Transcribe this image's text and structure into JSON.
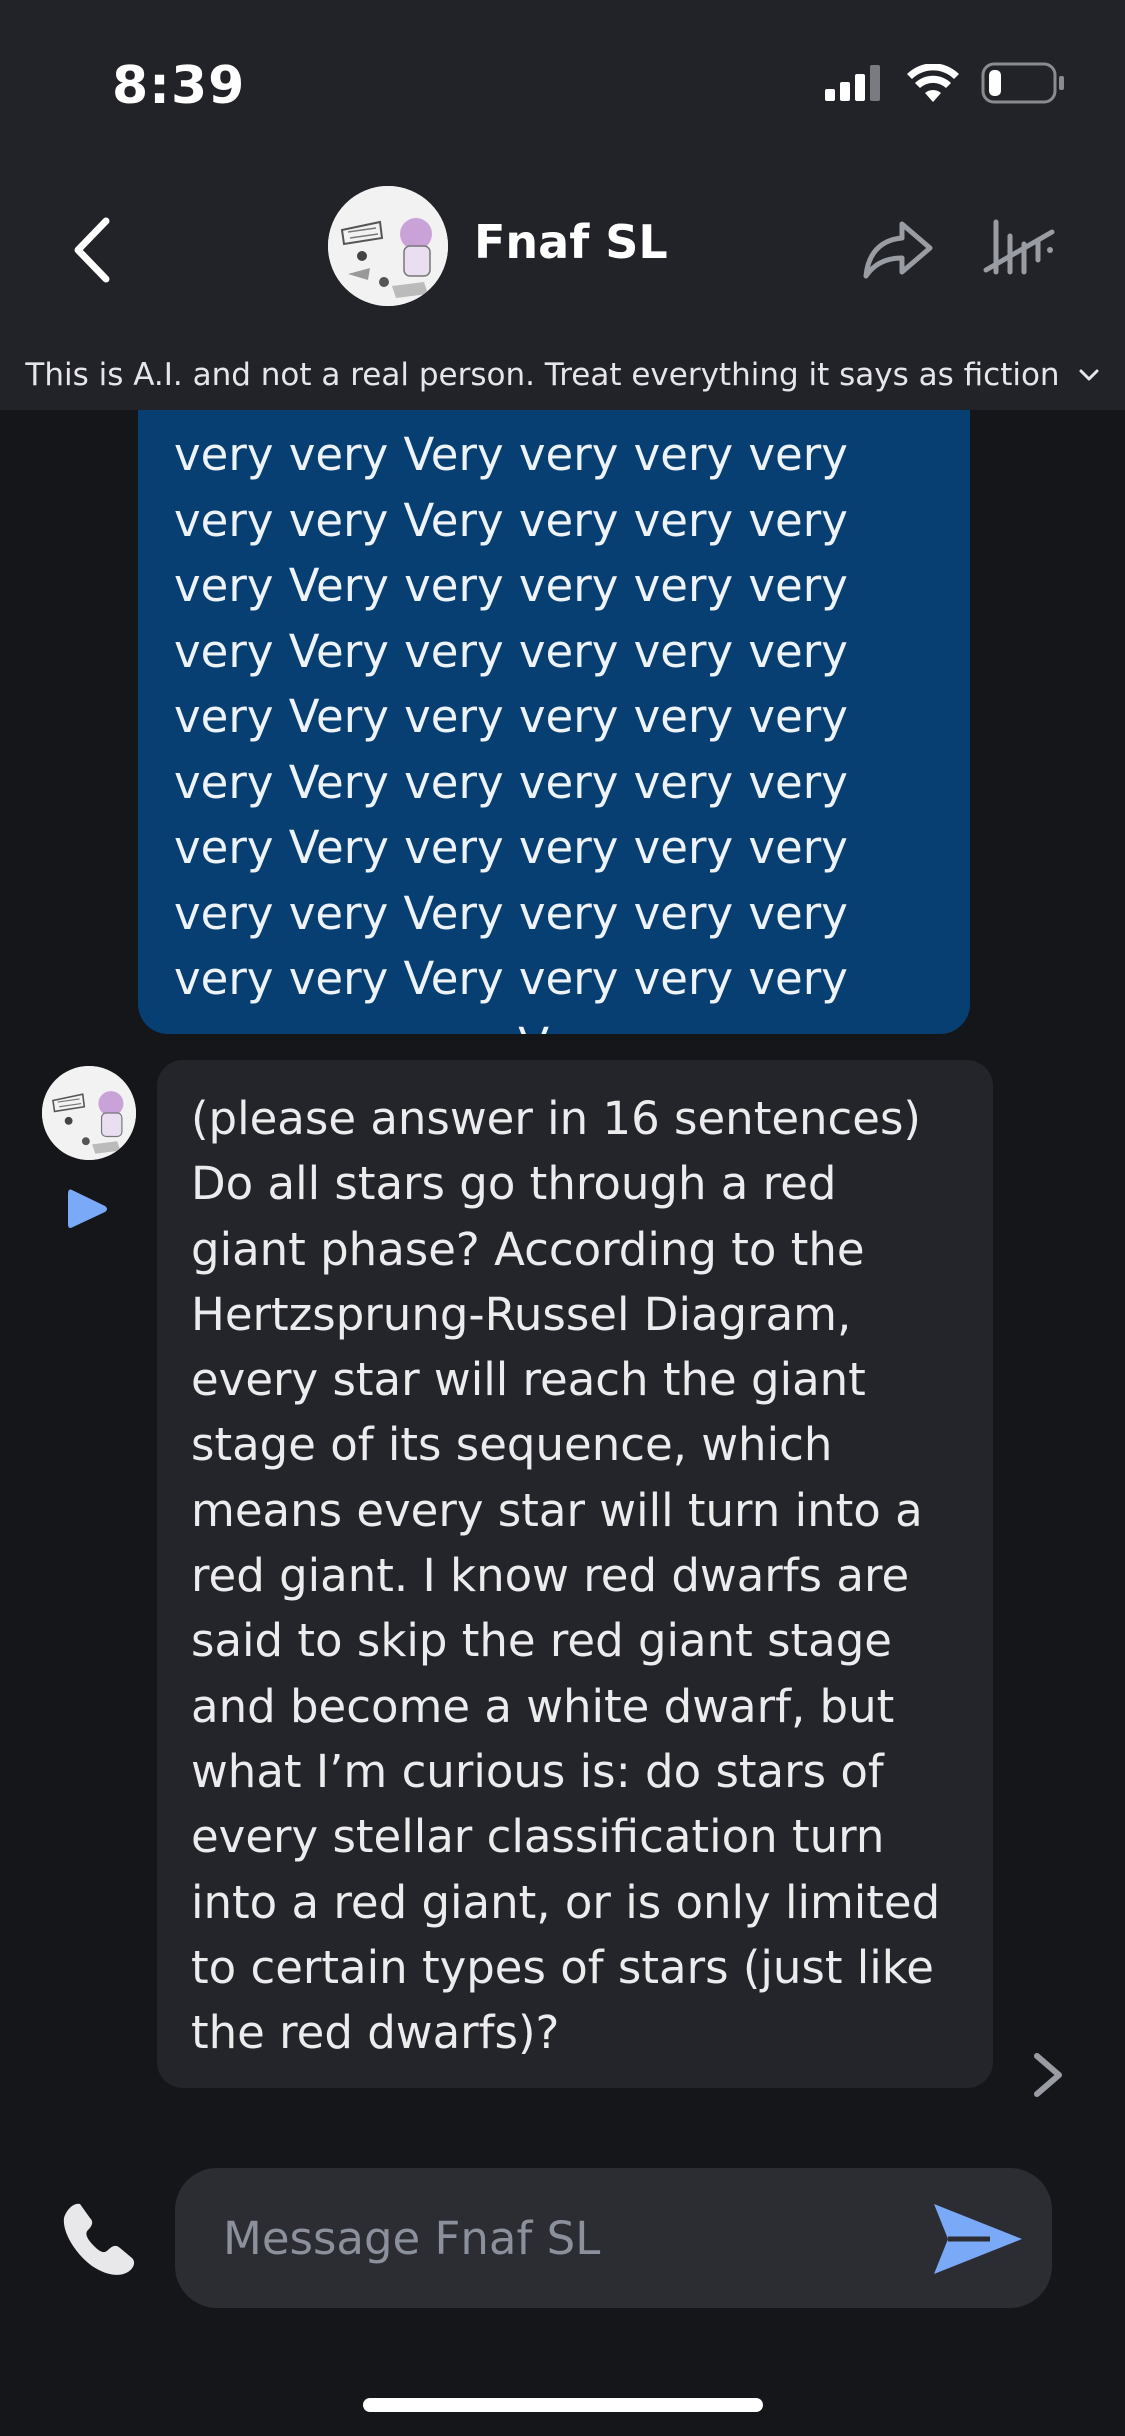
{
  "status_bar": {
    "time": "8:39",
    "icons": [
      "cellular-signal-icon",
      "wifi-icon",
      "battery-icon"
    ],
    "battery_level_percent": 20
  },
  "header": {
    "name": "Fnaf SL",
    "icons": [
      "back-chevron-icon",
      "avatar",
      "share-arrow-icon",
      "tally-bars-icon"
    ]
  },
  "disclaimer": {
    "text": "This is A.I. and not a real person. Treat everything it says as fiction",
    "icon": "chevron-down-icon"
  },
  "messages": {
    "user_text": "very very Very very very very very very Very very very very very Very very very very very very Very very very very very very Very very very very very very Very very very very very very Very very very very very very very Very very very very very very Very very very very very very very Very very very very very very much",
    "bot_text": "(please answer in 16 sentences) Do all stars go through a red giant phase? According to the Hertzsprung-Russel Diagram, every star will reach the giant stage of its sequence, which means every star will turn into a red giant. I know red dwarfs are said to skip the red giant stage and become a white dwarf, but what I’m curious is: do stars of every stellar classification turn into a red giant, or is only limited to certain types of stars (just like the red dwarfs)?"
  },
  "composer": {
    "placeholder": "Message Fnaf SL",
    "value": ""
  },
  "colors": {
    "user_bubble": "#073f72",
    "bot_bubble": "#24252a",
    "accent": "#7aa9f7",
    "background": "#15161a"
  }
}
